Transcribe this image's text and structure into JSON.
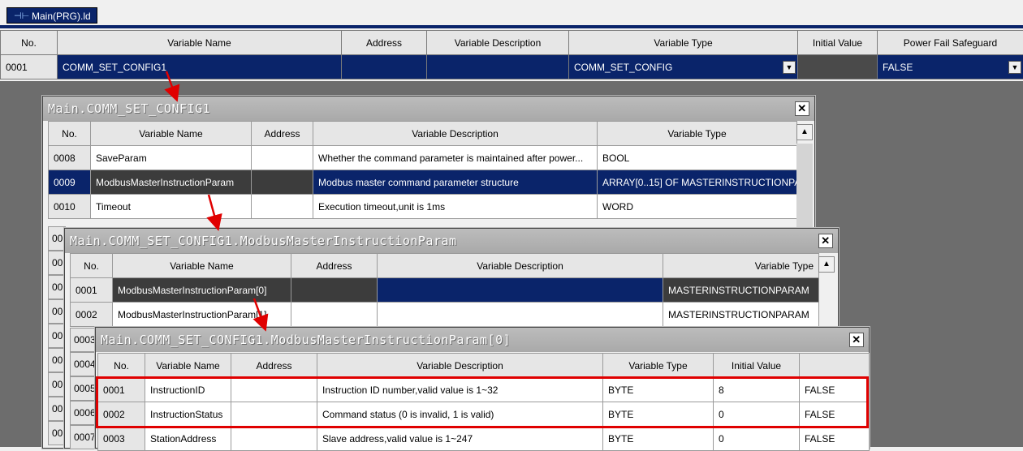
{
  "tab": {
    "label": "Main(PRG).ld"
  },
  "main_grid": {
    "headers": [
      "No.",
      "Variable Name",
      "Address",
      "Variable Description",
      "Variable Type",
      "Initial Value",
      "Power Fail Safeguard"
    ],
    "row": {
      "no": "0001",
      "name": "COMM_SET_CONFIG1",
      "address": "",
      "description": "",
      "type": "COMM_SET_CONFIG",
      "initial": "",
      "safeguard": "FALSE"
    }
  },
  "win1": {
    "title": "Main.COMM_SET_CONFIG1",
    "headers": [
      "No.",
      "Variable Name",
      "Address",
      "Variable Description",
      "Variable Type"
    ],
    "rows": [
      {
        "no": "0008",
        "name": "SaveParam",
        "address": "",
        "description": "Whether the command parameter is maintained after power...",
        "type": "BOOL"
      },
      {
        "no": "0009",
        "name": "ModbusMasterInstructionParam",
        "address": "",
        "description": "Modbus master command parameter structure",
        "type": "ARRAY[0..15] OF MASTERINSTRUCTIONPA"
      },
      {
        "no": "0010",
        "name": "Timeout",
        "address": "",
        "description": "Execution timeout,unit is 1ms",
        "type": "WORD"
      }
    ],
    "side_nos": [
      "00'",
      "00'",
      "00'",
      "00'",
      "00'",
      "00'",
      "00'",
      "00'",
      "00'"
    ]
  },
  "win2": {
    "title": "Main.COMM_SET_CONFIG1.ModbusMasterInstructionParam",
    "headers": [
      "No.",
      "Variable Name",
      "Address",
      "Variable Description",
      "Variable Type"
    ],
    "rows": [
      {
        "no": "0001",
        "name": "ModbusMasterInstructionParam[0]",
        "type": "MASTERINSTRUCTIONPARAM"
      },
      {
        "no": "0002",
        "name": "ModbusMasterInstructionParam[1]",
        "type": "MASTERINSTRUCTIONPARAM"
      }
    ],
    "side_nos": [
      "0003",
      "0004",
      "0005",
      "0006",
      "0007"
    ]
  },
  "win3": {
    "title": "Main.COMM_SET_CONFIG1.ModbusMasterInstructionParam[0]",
    "headers": [
      "No.",
      "Variable Name",
      "Address",
      "Variable Description",
      "Variable Type",
      "Initial Value",
      ""
    ],
    "rows": [
      {
        "no": "0001",
        "name": "InstructionID",
        "description": "Instruction ID number,valid value is 1~32",
        "type": "BYTE",
        "initial": "8",
        "extra": "FALSE"
      },
      {
        "no": "0002",
        "name": "InstructionStatus",
        "description": "Command status (0 is invalid, 1 is valid)",
        "type": "BYTE",
        "initial": "0",
        "extra": "FALSE"
      },
      {
        "no": "0003",
        "name": "StationAddress",
        "description": "Slave address,valid value is 1~247",
        "type": "BYTE",
        "initial": "0",
        "extra": "FALSE"
      }
    ]
  },
  "colors": {
    "selection": "#0a246a",
    "highlight_box": "#e00000",
    "arrow": "#e00000"
  }
}
